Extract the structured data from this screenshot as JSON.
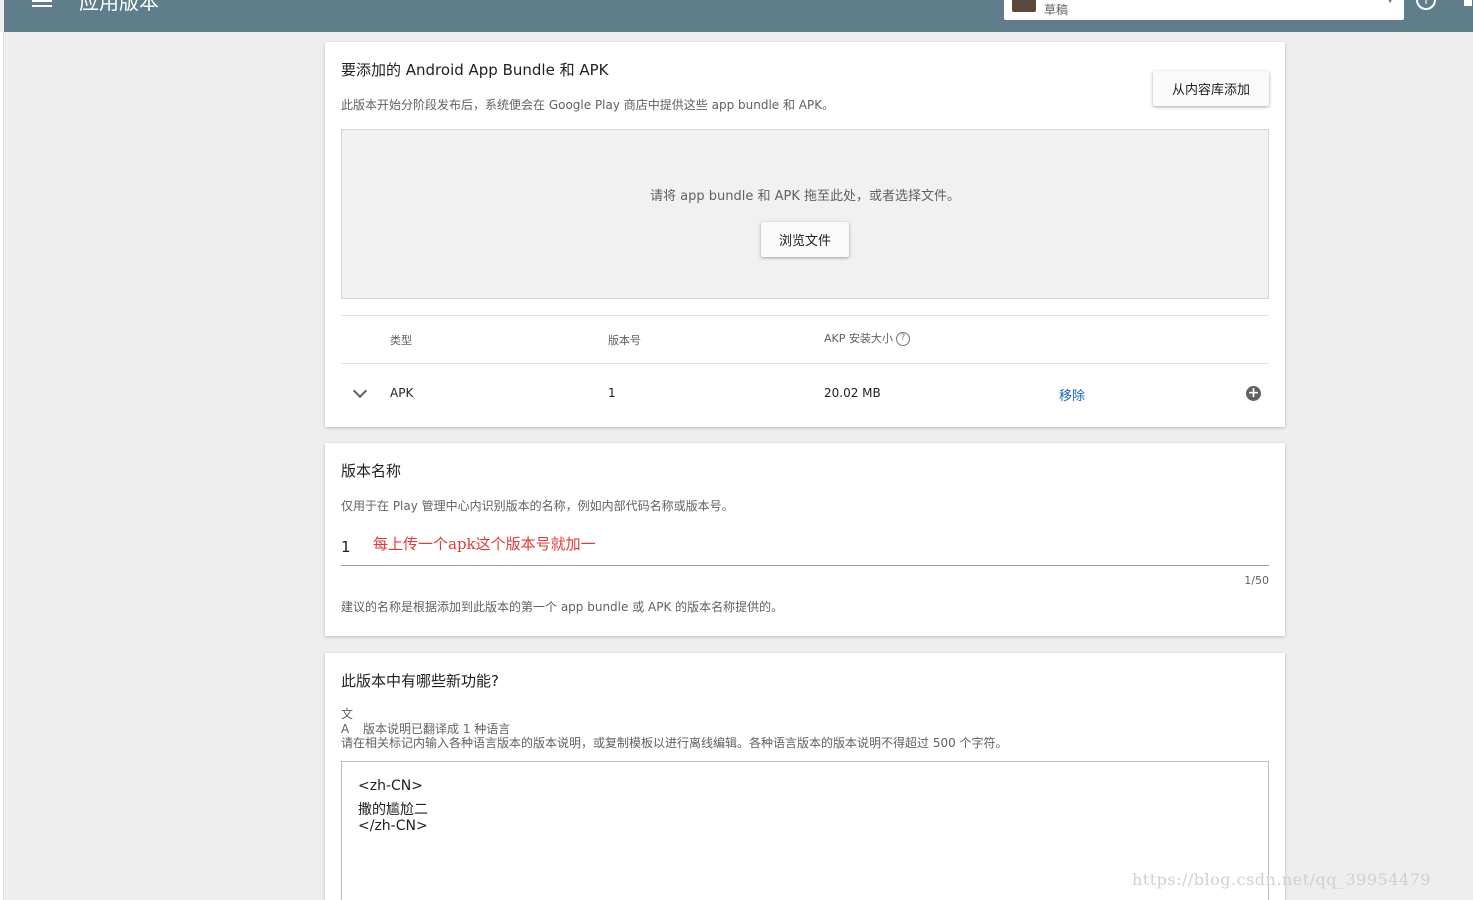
{
  "header": {
    "title": "应用版本",
    "track_label": "草稿",
    "info_glyph": "i",
    "colors": {
      "bar": "#607d8b"
    }
  },
  "bundles_card": {
    "title": "要添加的 Android App Bundle 和 APK",
    "description": "此版本开始分阶段发布后，系统便会在 Google Play 商店中提供这些 app bundle 和 APK。",
    "library_button": "从内容库添加",
    "dropzone_text": "请将 app bundle 和 APK 拖至此处，或者选择文件。",
    "browse_button": "浏览文件",
    "table": {
      "headers": {
        "type": "类型",
        "version_code": "版本号",
        "install_size": "AKP 安装大小"
      },
      "help_glyph": "?",
      "rows": [
        {
          "type": "APK",
          "version_code": "1",
          "install_size": "20.02 MB",
          "action": "移除",
          "add_glyph": "+"
        }
      ]
    }
  },
  "release_name_card": {
    "title": "版本名称",
    "description": "仅用于在 Play 管理中心内识别版本的名称，例如内部代码名称或版本号。",
    "value": "1",
    "annotation": "每上传一个apk这个版本号就加一",
    "counter": "1/50",
    "hint": "建议的名称是根据添加到此版本的第一个 app bundle 或 APK 的版本名称提供的。"
  },
  "whats_new_card": {
    "title": "此版本中有哪些新功能?",
    "translate_icon": "文A",
    "translated_note": "版本说明已翻译成 1 种语言",
    "instructions": "请在相关标记内输入各种语言版本的版本说明，或复制模板以进行离线编辑。各种语言版本的版本说明不得超过 500 个字符。",
    "notes_lines": [
      "<zh-CN>",
      "撒的尴尬二",
      "</zh-CN>"
    ]
  },
  "watermark": "https://blog.csdn.net/qq_39954479"
}
